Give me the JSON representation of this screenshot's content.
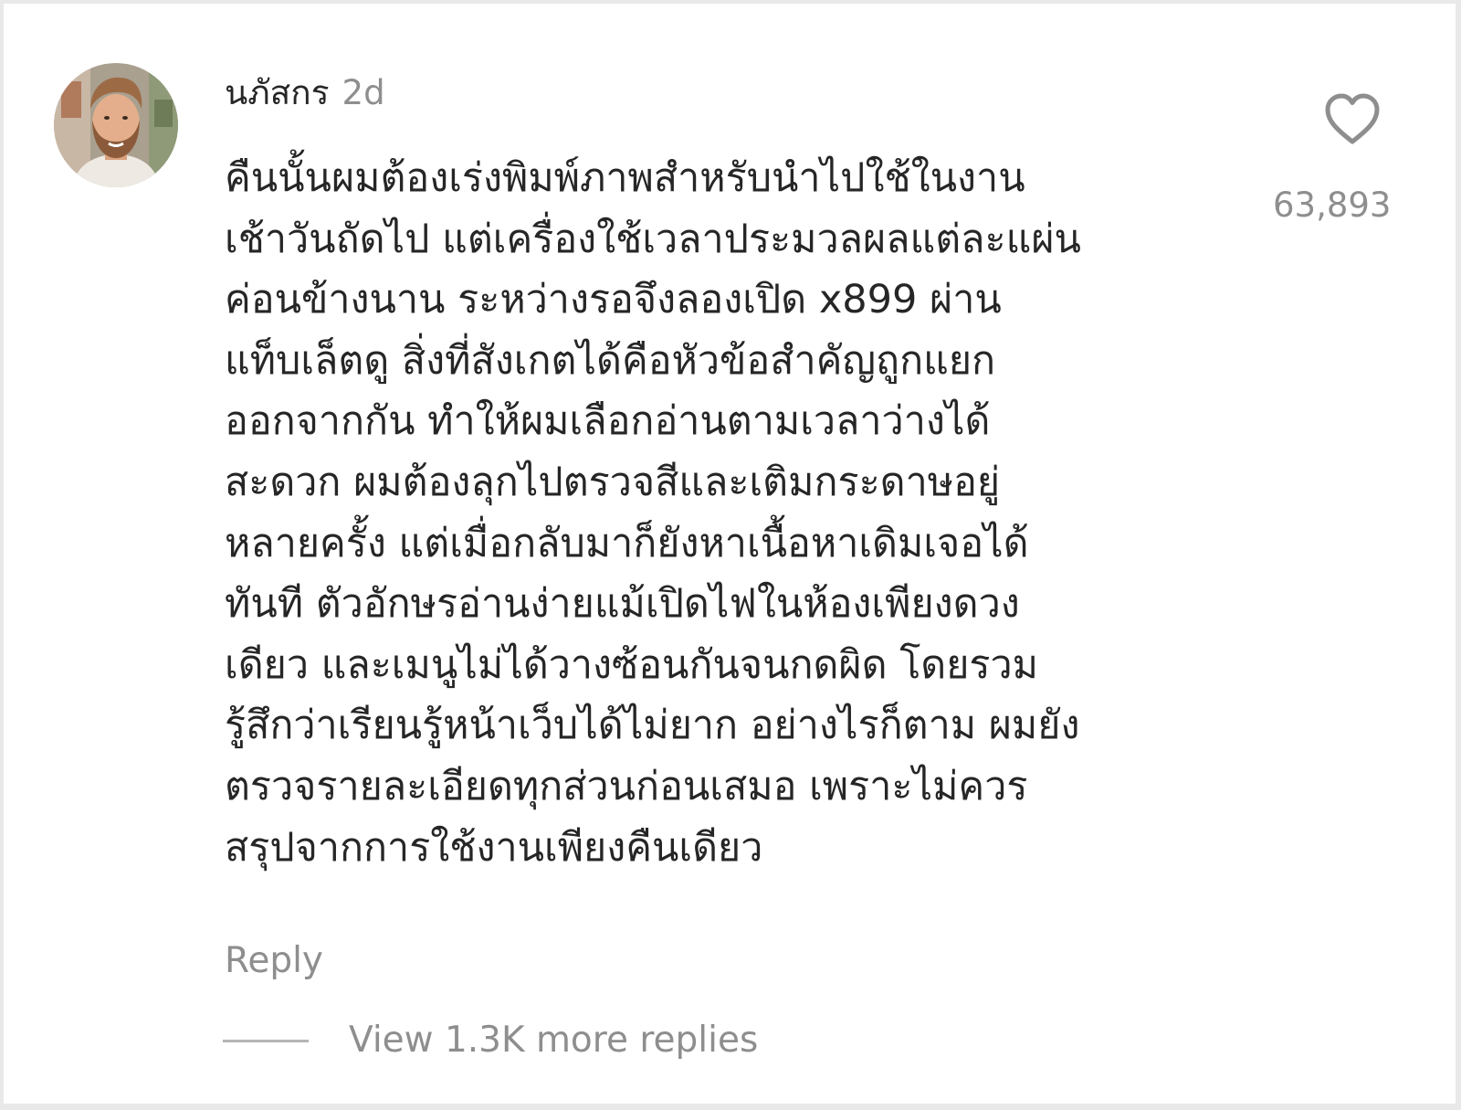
{
  "comment": {
    "username": "นภัสกร",
    "time_ago": "2d",
    "text_lines": [
      "คืนนั้นผมต้องเร่งพิมพ์ภาพสำหรับนำไปใช้ในงาน",
      "เช้าวันถัดไป แต่เครื่องใช้เวลาประมวลผลแต่ละแผ่น",
      "ค่อนข้างนาน ระหว่างรอจึงลองเปิด x899 ผ่าน",
      "แท็บเล็ตดู สิ่งที่สังเกตได้คือหัวข้อสำคัญถูกแยก",
      "ออกจากกัน ทำให้ผมเลือกอ่านตามเวลาว่างได้",
      "สะดวก ผมต้องลุกไปตรวจสีและเติมกระดาษอยู่",
      "หลายครั้ง แต่เมื่อกลับมาก็ยังหาเนื้อหาเดิมเจอได้",
      "ทันที ตัวอักษรอ่านง่ายแม้เปิดไฟในห้องเพียงดวง",
      "เดียว และเมนูไม่ได้วางซ้อนกันจนกดผิด โดยรวม",
      "รู้สึกว่าเรียนรู้หน้าเว็บได้ไม่ยาก อย่างไรก็ตาม ผมยัง",
      "ตรวจรายละเอียดทุกส่วนก่อนเสมอ เพราะไม่ควร",
      "สรุปจากการใช้งานเพียงคืนเดียว"
    ],
    "reply_label": "Reply",
    "like_count": "63,893",
    "like_icon": "heart-outline-icon",
    "view_replies_label": "View 1.3K more replies"
  },
  "colors": {
    "primary_text": "#262626",
    "secondary_text": "#8e8e8e",
    "divider": "#b5b5b5",
    "background": "#ffffff"
  }
}
